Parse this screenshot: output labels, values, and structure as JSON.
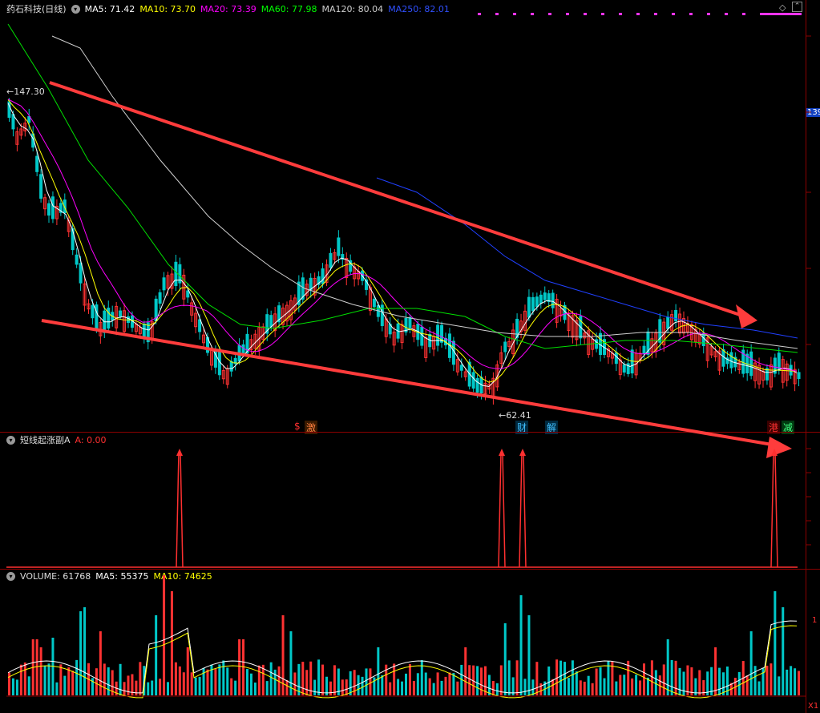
{
  "main": {
    "title": "药石科技(日线)",
    "ma": [
      {
        "label": "MA5: 71.42",
        "color": "#ffffff"
      },
      {
        "label": "MA10: 73.70",
        "color": "#ffff00"
      },
      {
        "label": "MA20: 73.39",
        "color": "#ff00ff"
      },
      {
        "label": "MA60: 77.98",
        "color": "#00ff00"
      },
      {
        "label": "MA120: 80.04",
        "color": "#d0d0d0"
      },
      {
        "label": "MA250: 82.01",
        "color": "#3050ff"
      }
    ],
    "high_label": "147.30",
    "low_label": "62.41",
    "right_price": "139",
    "events": [
      {
        "text": "$",
        "color": "#ff3030"
      },
      {
        "text": "激",
        "color": "#ff8040"
      },
      {
        "text": "财",
        "color": "#40c0ff"
      },
      {
        "text": "解",
        "color": "#40c0ff"
      },
      {
        "text": "港",
        "color": "#ff3030"
      },
      {
        "text": "减",
        "color": "#40ff80"
      }
    ]
  },
  "indicator": {
    "title": "短线起涨副A",
    "value_label": "A: 0.00"
  },
  "volume": {
    "title": "VOLUME: 61768",
    "ma5": "MA5: 55375",
    "ma10": "MA10: 74625",
    "axis_labels": [
      "1",
      "X1"
    ]
  },
  "colors": {
    "up": "#ff3232",
    "down": "#00c8c8",
    "trend": "#ff3c3c",
    "separator": "#8b0000"
  }
}
